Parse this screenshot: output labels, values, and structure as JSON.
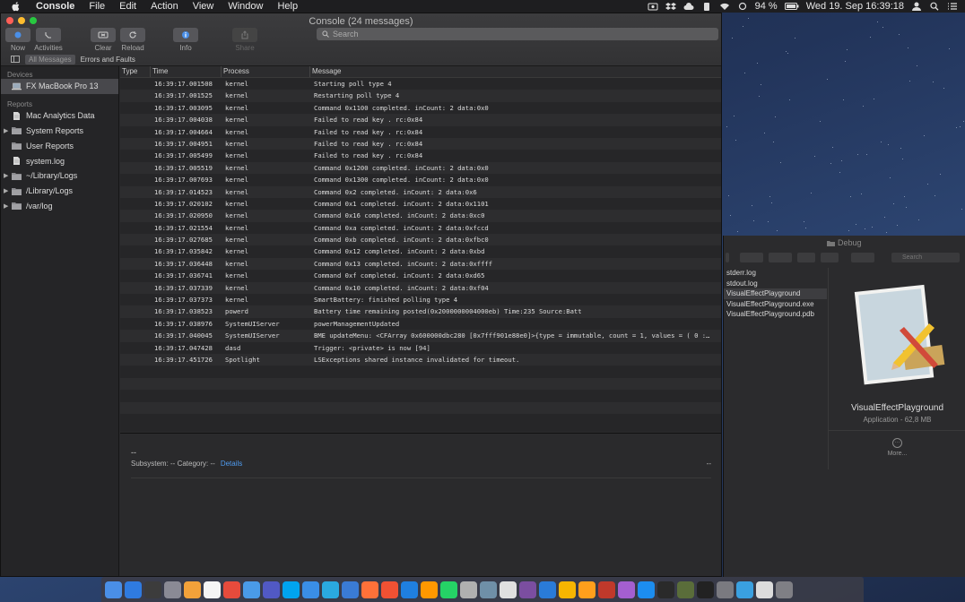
{
  "menubar": {
    "app_name": "Console",
    "items": [
      "File",
      "Edit",
      "Action",
      "View",
      "Window",
      "Help"
    ],
    "battery": "94 %",
    "datetime": "Wed 19. Sep  16:39:18"
  },
  "window": {
    "title": "Console (24 messages)",
    "toolbar": {
      "now": "Now",
      "activities": "Activities",
      "clear": "Clear",
      "reload": "Reload",
      "info": "Info",
      "share": "Share"
    },
    "search_placeholder": "Search",
    "filters": {
      "all": "All Messages",
      "errors": "Errors and Faults"
    }
  },
  "sidebar": {
    "devices_header": "Devices",
    "device": "FX MacBook Pro 13",
    "reports_header": "Reports",
    "reports": [
      {
        "label": "Mac Analytics Data",
        "icon": "document-icon",
        "expandable": false
      },
      {
        "label": "System Reports",
        "icon": "folder-icon",
        "expandable": true
      },
      {
        "label": "User Reports",
        "icon": "folder-icon",
        "expandable": false
      },
      {
        "label": "system.log",
        "icon": "document-icon",
        "expandable": false
      },
      {
        "label": "~/Library/Logs",
        "icon": "folder-icon",
        "expandable": true
      },
      {
        "label": "/Library/Logs",
        "icon": "folder-icon",
        "expandable": true
      },
      {
        "label": "/var/log",
        "icon": "folder-icon",
        "expandable": true
      }
    ]
  },
  "table": {
    "columns": [
      "Type",
      "Time",
      "Process",
      "Message"
    ],
    "rows": [
      [
        "",
        "16:39:17.001508",
        "kernel",
        "Starting poll type 4"
      ],
      [
        "",
        "16:39:17.001525",
        "kernel",
        "Restarting poll type 4"
      ],
      [
        "",
        "16:39:17.003095",
        "kernel",
        "Command 0x1100 completed. inCount: 2 data:0x0"
      ],
      [
        "",
        "16:39:17.004038",
        "kernel",
        "Failed to read key     . rc:0x84"
      ],
      [
        "",
        "16:39:17.004664",
        "kernel",
        "Failed to read key     . rc:0x84"
      ],
      [
        "",
        "16:39:17.004951",
        "kernel",
        "Failed to read key     . rc:0x84"
      ],
      [
        "",
        "16:39:17.005499",
        "kernel",
        "Failed to read key     . rc:0x84"
      ],
      [
        "",
        "16:39:17.005519",
        "kernel",
        "Command 0x1200 completed. inCount: 2 data:0x0"
      ],
      [
        "",
        "16:39:17.007693",
        "kernel",
        "Command 0x1300 completed. inCount: 2 data:0x0"
      ],
      [
        "",
        "16:39:17.014523",
        "kernel",
        "Command 0x2 completed. inCount: 2 data:0x6"
      ],
      [
        "",
        "16:39:17.020102",
        "kernel",
        "Command 0x1 completed. inCount: 2 data:0x1101"
      ],
      [
        "",
        "16:39:17.020950",
        "kernel",
        "Command 0x16 completed. inCount: 2 data:0xc0"
      ],
      [
        "",
        "16:39:17.021554",
        "kernel",
        "Command 0xa completed. inCount: 2 data:0xfccd"
      ],
      [
        "",
        "16:39:17.027685",
        "kernel",
        "Command 0xb completed. inCount: 2 data:0xfbc0"
      ],
      [
        "",
        "16:39:17.035842",
        "kernel",
        "Command 0x12 completed. inCount: 2 data:0xbd"
      ],
      [
        "",
        "16:39:17.036448",
        "kernel",
        "Command 0x13 completed. inCount: 2 data:0xffff"
      ],
      [
        "",
        "16:39:17.036741",
        "kernel",
        "Command 0xf completed. inCount: 2 data:0xd65"
      ],
      [
        "",
        "16:39:17.037339",
        "kernel",
        "Command 0x10 completed. inCount: 2 data:0xf04"
      ],
      [
        "",
        "16:39:17.037373",
        "kernel",
        "SmartBattery: finished polling type 4"
      ],
      [
        "",
        "16:39:17.038523",
        "powerd",
        "Battery time remaining posted(0x2000000004000eb) Time:235 Source:Batt"
      ],
      [
        "",
        "16:39:17.038976",
        "SystemUIServer",
        "powerManagementUpdated"
      ],
      [
        "",
        "16:39:17.040045",
        "SystemUIServer",
        "BME updateMenu: <CFArray 0x600000dbc280 [0x7fff901e88e0]>{type = immutable, count = 1, values = (  0 :…"
      ],
      [
        "",
        "16:39:17.047428",
        "dasd",
        "Trigger: <private> is now [94]"
      ],
      [
        "",
        "16:39:17.451726",
        "Spotlight",
        "LSExceptions shared instance invalidated for timeout."
      ]
    ]
  },
  "detail": {
    "dash": "--",
    "subsystem": "Subsystem: --   Category: --",
    "details_link": "Details",
    "right": "--"
  },
  "finder": {
    "title": "Debug",
    "search_placeholder": "Search",
    "files": [
      "stderr.log",
      "stdout.log",
      "VisualEffectPlayground",
      "VisualEffectPlayground.exe",
      "VisualEffectPlayground.pdb"
    ],
    "selected_file_index": 2,
    "preview_name": "VisualEffectPlayground",
    "preview_kind": "Application - 62,8 MB",
    "more": "More..."
  },
  "dock": {
    "icons": [
      "finder-icon",
      "safari-icon",
      "console-icon",
      "launchpad-icon",
      "home-icon",
      "calendar-icon",
      "chrome-icon",
      "mail-icon",
      "teams-icon",
      "skype-icon",
      "messages-icon",
      "tweetbot-icon",
      "keynote-icon",
      "firefox-icon",
      "git-icon",
      "xcode-icon",
      "sublime-icon",
      "whatsapp-icon",
      "elephant-icon",
      "preview-icon",
      "vpn-icon",
      "visual-studio-icon",
      "vscode-icon",
      "sketch-icon",
      "pawprint-icon",
      "tower-icon",
      "podcast-icon",
      "app-store-icon",
      "activity-monitor-icon",
      "scrivener-icon",
      "terminal-icon",
      "system-preferences-icon",
      "network-icon",
      "folder-icon",
      "trash-icon"
    ],
    "colors": [
      "#4a8fe7",
      "#2f7be0",
      "#3c3c3c",
      "#8a8a95",
      "#f2a13a",
      "#f5f5f5",
      "#e64b3c",
      "#4a9be8",
      "#5159c4",
      "#00a4ef",
      "#3a8ee6",
      "#2aa9e0",
      "#3a7bd5",
      "#ff7139",
      "#f05133",
      "#1f7fe0",
      "#ff9800",
      "#25d366",
      "#b0b0b0",
      "#6f8fa8",
      "#e0e0e0",
      "#7b4ea0",
      "#2a7bd8",
      "#f7b500",
      "#ff9f1c",
      "#c0392b",
      "#a45fd0",
      "#1c8df0",
      "#2a2a2a",
      "#5a6d3a",
      "#222",
      "#7a7a80",
      "#3aa0e0",
      "#dcdcdc",
      "#7f7f85"
    ]
  }
}
